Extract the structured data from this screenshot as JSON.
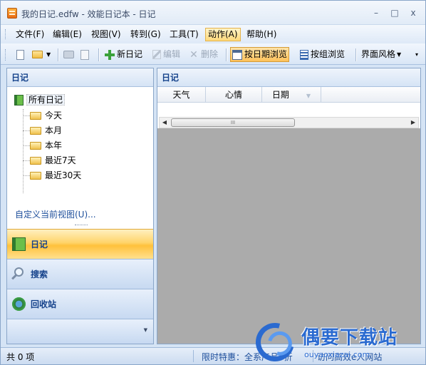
{
  "window": {
    "title": "我的日记.edfw - 效能日记本 - 日记",
    "minimize_glyph": "–",
    "maximize_glyph": "□",
    "close_glyph": "x"
  },
  "menu": [
    "文件(F)",
    "编辑(E)",
    "视图(V)",
    "转到(G)",
    "工具(T)",
    "动作(A)",
    "帮助(H)"
  ],
  "menu_active_index": 5,
  "toolbar": {
    "new_diary": "新日记",
    "edit": "编辑",
    "delete": "删除",
    "browse_by_date": "按日期浏览",
    "browse_by_group": "按组浏览",
    "ui_style": "界面风格"
  },
  "left_panel": {
    "header": "日记",
    "tree_root": "所有日记",
    "tree_children": [
      "今天",
      "本月",
      "本年",
      "最近7天",
      "最近30天"
    ],
    "custom_view_link": "自定义当前视图(U)...",
    "nav_buttons": [
      "日记",
      "搜索",
      "回收站"
    ],
    "nav_selected_index": 0
  },
  "right_panel": {
    "header": "日记",
    "columns": [
      "天气",
      "心情",
      "日期"
    ],
    "scroll_thumb": "III"
  },
  "status": {
    "count": "共 0 项",
    "link_promo": "限时特惠：全系产品5折",
    "link_site": "访问高效e人网站"
  },
  "watermark": {
    "title": "偶要下载站",
    "url": "ouyaoxiazai.com"
  },
  "colors": {
    "accent_orange": "#ffc13b",
    "header_blue": "#15428b",
    "panel_border": "#8aa6c9",
    "watermark_blue": "#2a6ad0"
  }
}
